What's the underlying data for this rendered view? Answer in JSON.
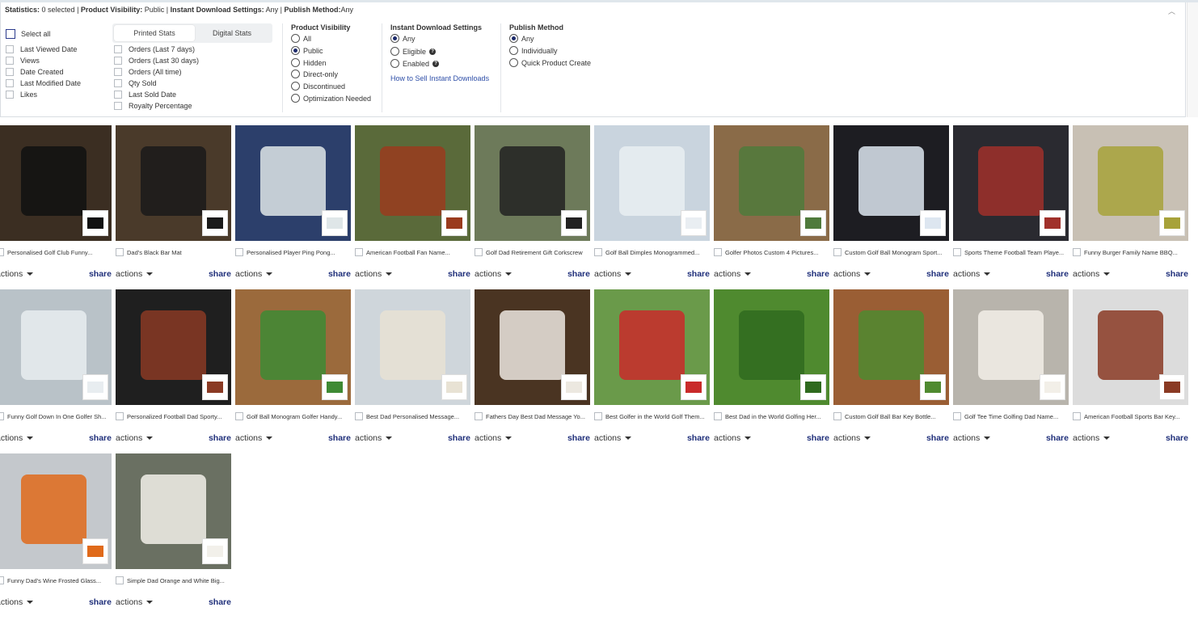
{
  "statistics": {
    "prefix": "Statistics:",
    "selected": "0 selected",
    "visibility_label": "Product Visibility:",
    "visibility_value": "Public",
    "instant_label": "Instant Download Settings:",
    "instant_value": "Any",
    "publish_label": "Publish Method:",
    "publish_value": "Any"
  },
  "filters": {
    "select_all": "Select all",
    "left_stats": [
      "Last Viewed Date",
      "Views",
      "Date Created",
      "Last Modified Date",
      "Likes"
    ],
    "tabs": [
      "Printed Stats",
      "Digital Stats"
    ],
    "printed_stats": [
      "Orders (Last 7 days)",
      "Orders (Last 30 days)",
      "Orders (All time)",
      "Qty Sold",
      "Last Sold Date",
      "Royalty Percentage"
    ],
    "visibility": {
      "title": "Product Visibility",
      "options": [
        "All",
        "Public",
        "Hidden",
        "Direct-only",
        "Discontinued",
        "Optimization Needed"
      ]
    },
    "instant": {
      "title": "Instant Download Settings",
      "options": [
        "Any",
        "Eligible",
        "Enabled"
      ],
      "link": "How to Sell Instant Downloads"
    },
    "publish": {
      "title": "Publish Method",
      "options": [
        "Any",
        "Individually",
        "Quick Product Create"
      ]
    }
  },
  "product_labels": {
    "actions": "actions",
    "share": "share"
  },
  "products": [
    {
      "title": "Personalised Golf Club Funny...",
      "bg": "#3b2e22",
      "accent": "#111111"
    },
    {
      "title": "Dad's Black Bar Mat",
      "bg": "#4a3a2a",
      "accent": "#1a1a1a"
    },
    {
      "title": "Personalised Player Ping Pong...",
      "bg": "#2c3f6b",
      "accent": "#dfe6e8"
    },
    {
      "title": "American Football Fan Name...",
      "bg": "#5a6a3a",
      "accent": "#9a3b1e"
    },
    {
      "title": "Golf Dad Retirement Gift Corkscrew",
      "bg": "#6d7a5a",
      "accent": "#222222"
    },
    {
      "title": "Golf Ball Dimples Monogrammed...",
      "bg": "#c9d4de",
      "accent": "#e9eef2"
    },
    {
      "title": "Golfer Photos Custom 4 Pictures...",
      "bg": "#8a6b48",
      "accent": "#4f7a3c"
    },
    {
      "title": "Custom Golf Ball Monogram Sport...",
      "bg": "#1d1d22",
      "accent": "#dde6f0"
    },
    {
      "title": "Sports Theme Football Team Playe...",
      "bg": "#2a2a30",
      "accent": "#a0302a"
    },
    {
      "title": "Funny Burger Family Name BBQ...",
      "bg": "#c8c0b4",
      "accent": "#a7a23a"
    },
    {
      "title": "Funny Golf Down In One Golfer Sh...",
      "bg": "#b9c2c8",
      "accent": "#e8edf0"
    },
    {
      "title": "Personalized Football Dad Sporty...",
      "bg": "#1f1f1f",
      "accent": "#8a3a24"
    },
    {
      "title": "Golf Ball Monogram Golfer Handy...",
      "bg": "#9b6a3c",
      "accent": "#3e8a34"
    },
    {
      "title": "Best Dad Personalised Message...",
      "bg": "#cfd6db",
      "accent": "#e8e2d4"
    },
    {
      "title": "Fathers Day Best Dad Message Yo...",
      "bg": "#4a3422",
      "accent": "#ece8e0"
    },
    {
      "title": "Best Golfer in the World Golf Them...",
      "bg": "#6a9a4a",
      "accent": "#c92a2a"
    },
    {
      "title": "Best Dad in the World Golfing Her...",
      "bg": "#4f8a2f",
      "accent": "#2f6a1e"
    },
    {
      "title": "Custom Golf Ball Bar Key Bottle...",
      "bg": "#9a5e34",
      "accent": "#4f8a30"
    },
    {
      "title": "Golf Tee Time Golfing Dad Name...",
      "bg": "#b8b4ac",
      "accent": "#f2efe8"
    },
    {
      "title": "American Football Sports Bar Key...",
      "bg": "#dcdcdc",
      "accent": "#8a3a24"
    },
    {
      "title": "Funny Dad's Wine Frosted Glass...",
      "bg": "#c4c8cc",
      "accent": "#e06a1a"
    },
    {
      "title": "Simple Dad Orange and White Big...",
      "bg": "#6a7062",
      "accent": "#f2f0ea"
    }
  ]
}
